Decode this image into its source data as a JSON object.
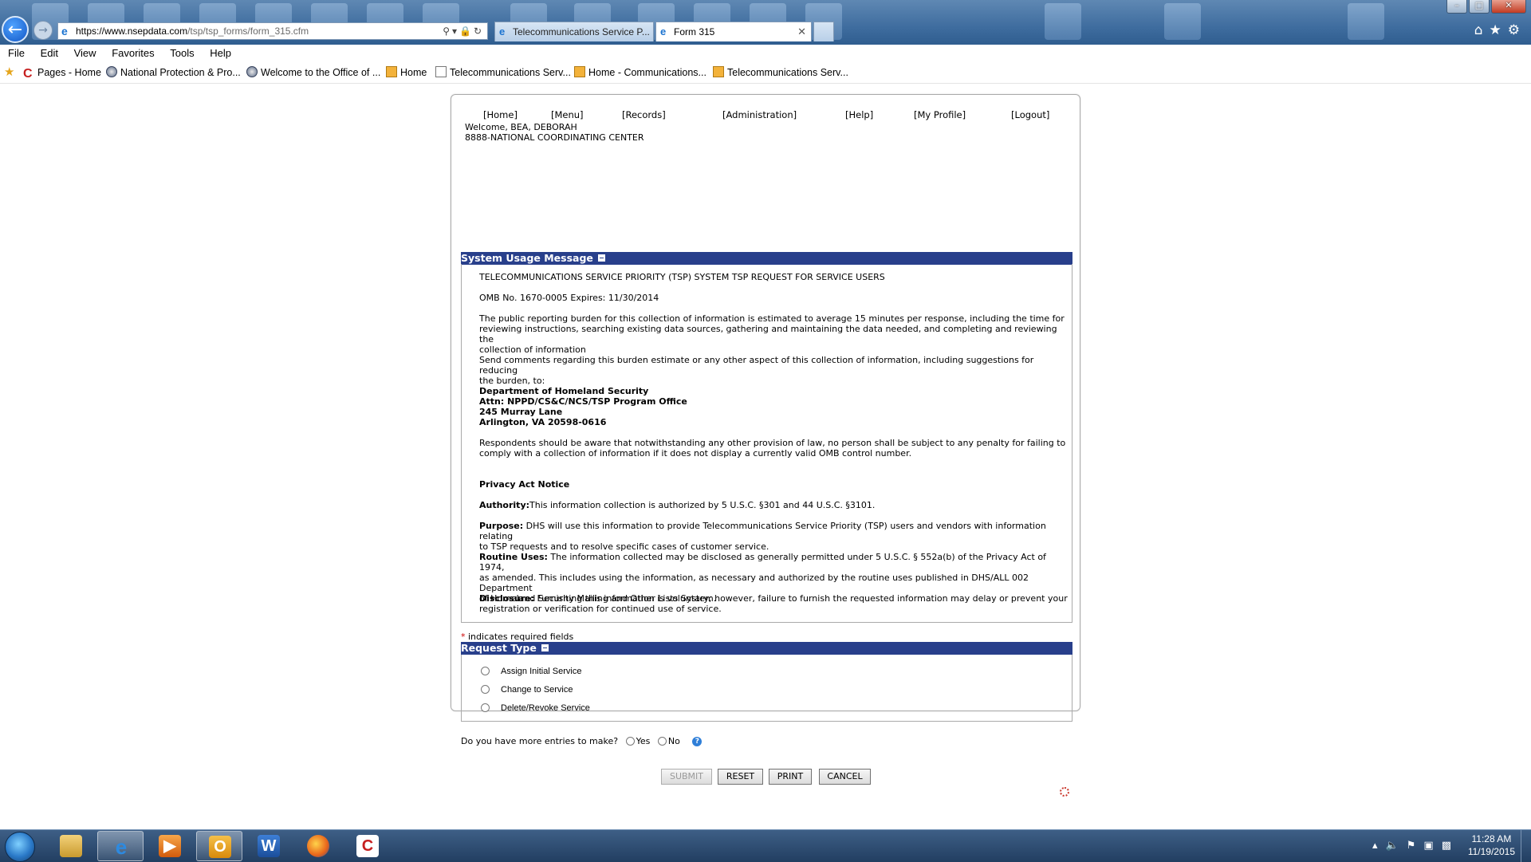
{
  "browser": {
    "url_host": "https://www.nsepdata.com",
    "url_path": "/tsp/tsp_forms/form_315.cfm",
    "tabs": [
      {
        "label": "Telecommunications Service P..."
      },
      {
        "label": "Form 315"
      }
    ],
    "menu": [
      "File",
      "Edit",
      "View",
      "Favorites",
      "Tools",
      "Help"
    ],
    "favorites": [
      {
        "label": "Pages - Home",
        "icon": "c-logo-icon"
      },
      {
        "label": "National Protection & Pro...",
        "icon": "seal-icon"
      },
      {
        "label": "Welcome to the Office of ...",
        "icon": "seal-icon"
      },
      {
        "label": "Home",
        "icon": "page-icon"
      },
      {
        "label": "Telecommunications Serv...",
        "icon": "doc-icon"
      },
      {
        "label": "Home - Communications...",
        "icon": "page-icon"
      },
      {
        "label": "Telecommunications Serv...",
        "icon": "page-icon"
      }
    ]
  },
  "nav": [
    "[Home]",
    "[Menu]",
    "[Records]",
    "[Administration]",
    "[Help]",
    "[My Profile]",
    "[Logout]"
  ],
  "welcome": {
    "line1": "Welcome, BEA, DEBORAH",
    "line2": "8888-NATIONAL COORDINATING CENTER"
  },
  "usage": {
    "title": "System Usage Message",
    "heading": "TELECOMMUNICATIONS SERVICE PRIORITY (TSP) SYSTEM TSP REQUEST FOR SERVICE USERS",
    "omb": "OMB No. 1670-0005 Expires: 11/30/2014",
    "burden_l1": "The public reporting burden for this collection of information is estimated to average 15 minutes per response, including the time for",
    "burden_l2": "reviewing instructions, searching existing data sources, gathering and maintaining the data needed, and completing and reviewing the",
    "burden_l3": "collection of information",
    "comments_l1": "Send comments regarding this burden estimate or any other aspect of this collection of information, including suggestions for reducing",
    "comments_l2": "the burden, to:",
    "address": [
      "Department of Homeland Security",
      "Attn: NPPD/CS&C/NCS/TSP Program Office",
      "245 Murray Lane",
      "Arlington, VA 20598-0616"
    ],
    "respondents_l1": "Respondents should be aware that notwithstanding any other provision of law, no person shall be subject to any penalty for failing to",
    "respondents_l2": "comply with a collection of information if it does not display a currently valid OMB control number.",
    "privacy_title": "Privacy Act Notice",
    "authority_label": "Authority:",
    "authority_text": "This information collection is authorized by 5 U.S.C. §301 and 44 U.S.C. §3101.",
    "purpose_label": "Purpose:",
    "purpose_l1": " DHS will use this information to provide Telecommunications Service Priority (TSP) users and vendors with information relating",
    "purpose_l2": "to TSP requests and to resolve specific cases of customer service.",
    "routine_label": "Routine Uses:",
    "routine_l1": " The information collected may be disclosed as generally permitted under 5 U.S.C. § 552a(b) of the Privacy Act of 1974,",
    "routine_l2": "as amended. This includes using the information, as necessary and authorized by the routine uses published in DHS/ALL 002 Department",
    "routine_l3": "of Homeland Security Mailing and Other Lists System.",
    "disclosure_label": "Disclosure:",
    "disclosure_l1": " Furnishing this information is voluntary; however, failure to furnish the requested information may delay or prevent your",
    "disclosure_l2": "registration or verification for continued use of service."
  },
  "required_note": {
    "star": "*",
    "text": " indicates required fields"
  },
  "request_type": {
    "title": "Request Type",
    "options": [
      "Assign Initial Service",
      "Change to Service",
      "Delete/Revoke Service"
    ]
  },
  "more_entries": {
    "question": "Do you have more entries to make?",
    "yes": "Yes",
    "no": "No"
  },
  "buttons": {
    "submit": "SUBMIT",
    "reset": "RESET",
    "print": "PRINT",
    "cancel": "CANCEL"
  },
  "taskbar": {
    "time": "11:28 AM",
    "date": "11/19/2015"
  }
}
